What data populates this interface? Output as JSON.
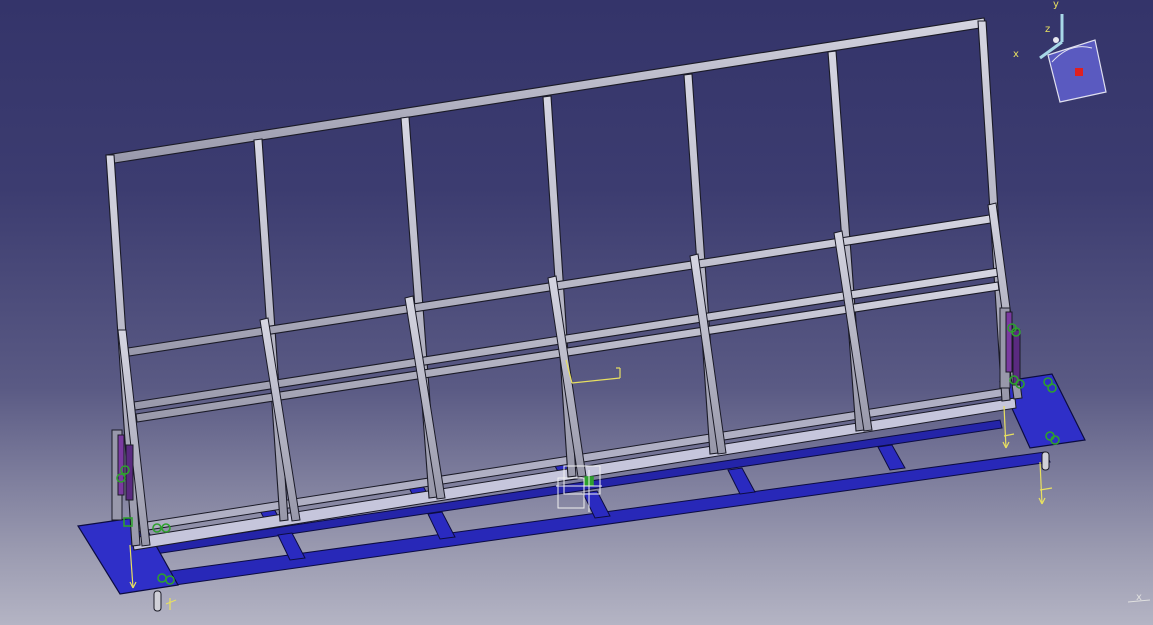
{
  "viewer": {
    "compass": {
      "x_label": "x",
      "y_label": "y",
      "z_label": "z"
    },
    "corner_axis_label": "x",
    "colors": {
      "background_top": "#34346a",
      "background_bottom": "#b4b4c4",
      "frame_tube": "#b9b9c8",
      "frame_tube_edge": "#1a1a26",
      "base_plate": "#2f2fc8",
      "base_rail": "#2626b4",
      "constraint_marker": "#2ea02e",
      "anchor_axis": "#e8e060",
      "hydraulic_piston": "#7a3aa0"
    }
  }
}
